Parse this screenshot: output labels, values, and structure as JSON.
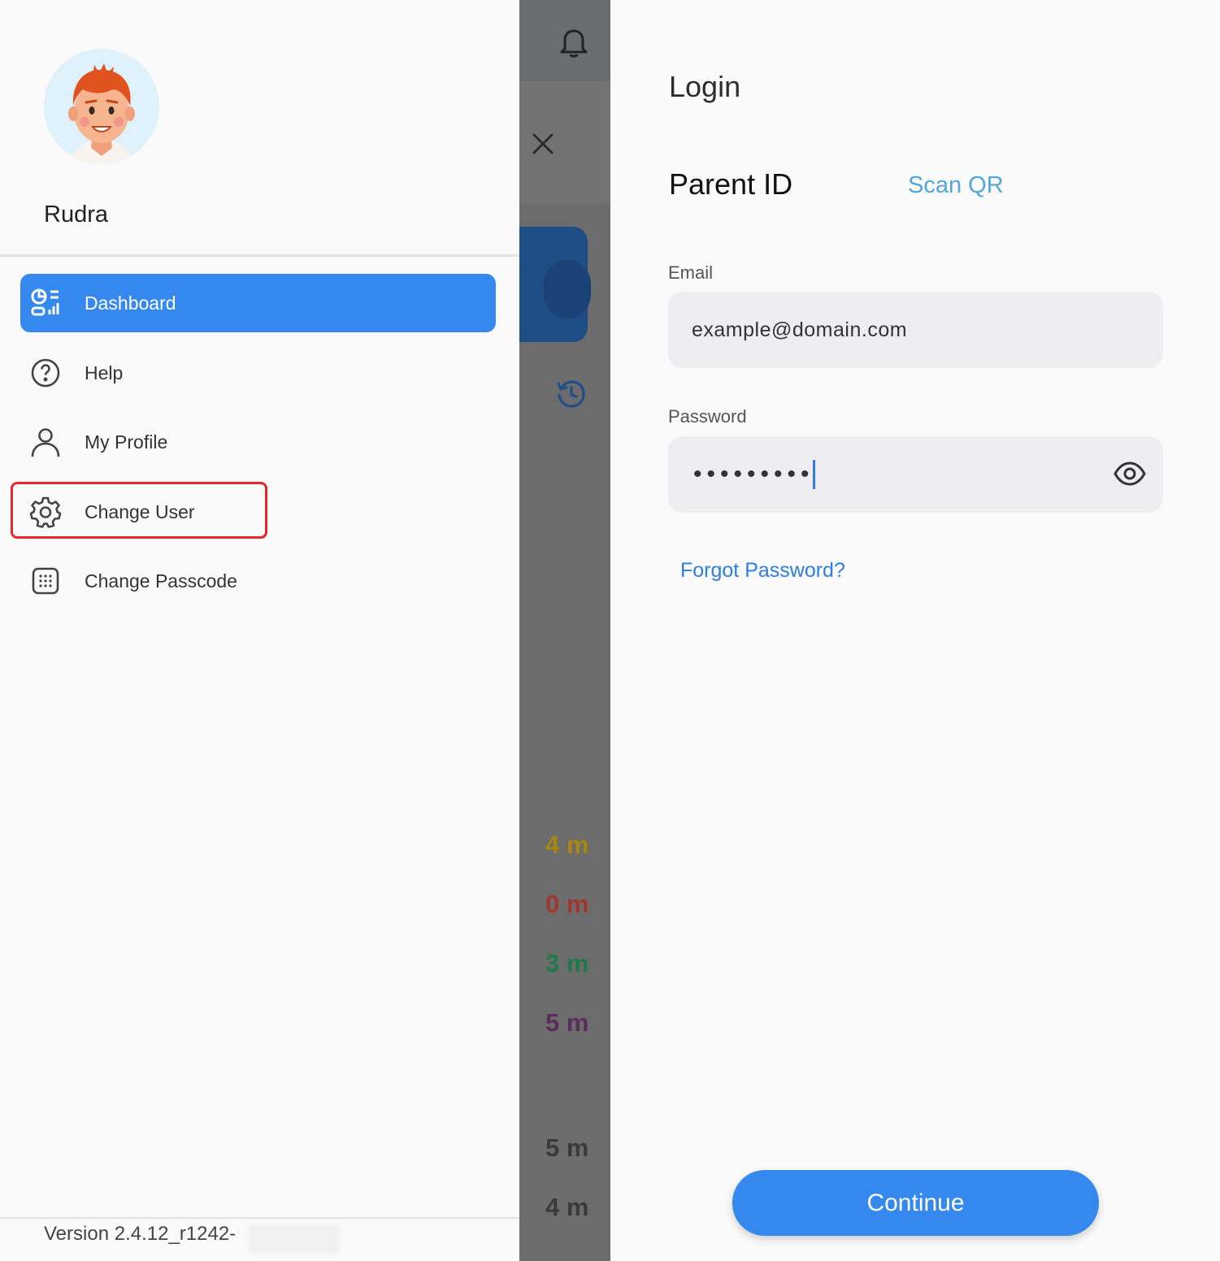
{
  "user": {
    "name": "Rudra"
  },
  "drawer": {
    "items": [
      {
        "label": "Dashboard",
        "icon": "dashboard-icon",
        "active": true
      },
      {
        "label": "Help",
        "icon": "help-circle-icon",
        "active": false
      },
      {
        "label": "My Profile",
        "icon": "person-icon",
        "active": false
      },
      {
        "label": "Change User",
        "icon": "gear-icon",
        "active": false,
        "highlighted": true
      },
      {
        "label": "Change Passcode",
        "icon": "keypad-icon",
        "active": false
      }
    ],
    "version": "Version 2.4.12_r1242-"
  },
  "background": {
    "minutes": [
      {
        "text": "4 m",
        "color": "#a8870f"
      },
      {
        "text": "0 m",
        "color": "#a2362c"
      },
      {
        "text": "3 m",
        "color": "#1f7a4a"
      },
      {
        "text": "5 m",
        "color": "#5a2c5e"
      },
      {
        "text": "5 m",
        "color": "#3a3a3a"
      },
      {
        "text": "4 m",
        "color": "#3a3a3a"
      }
    ]
  },
  "login": {
    "title": "Login",
    "section_title": "Parent ID",
    "scan_qr": "Scan QR",
    "email_label": "Email",
    "email_value": "example@domain.com",
    "password_label": "Password",
    "password_value": "•••••••••",
    "forgot": "Forgot Password?",
    "continue": "Continue"
  },
  "colors": {
    "accent": "#3589ee",
    "highlight": "#e8262b",
    "link": "#2c7ee3",
    "scan_qr": "#53a6d8"
  }
}
